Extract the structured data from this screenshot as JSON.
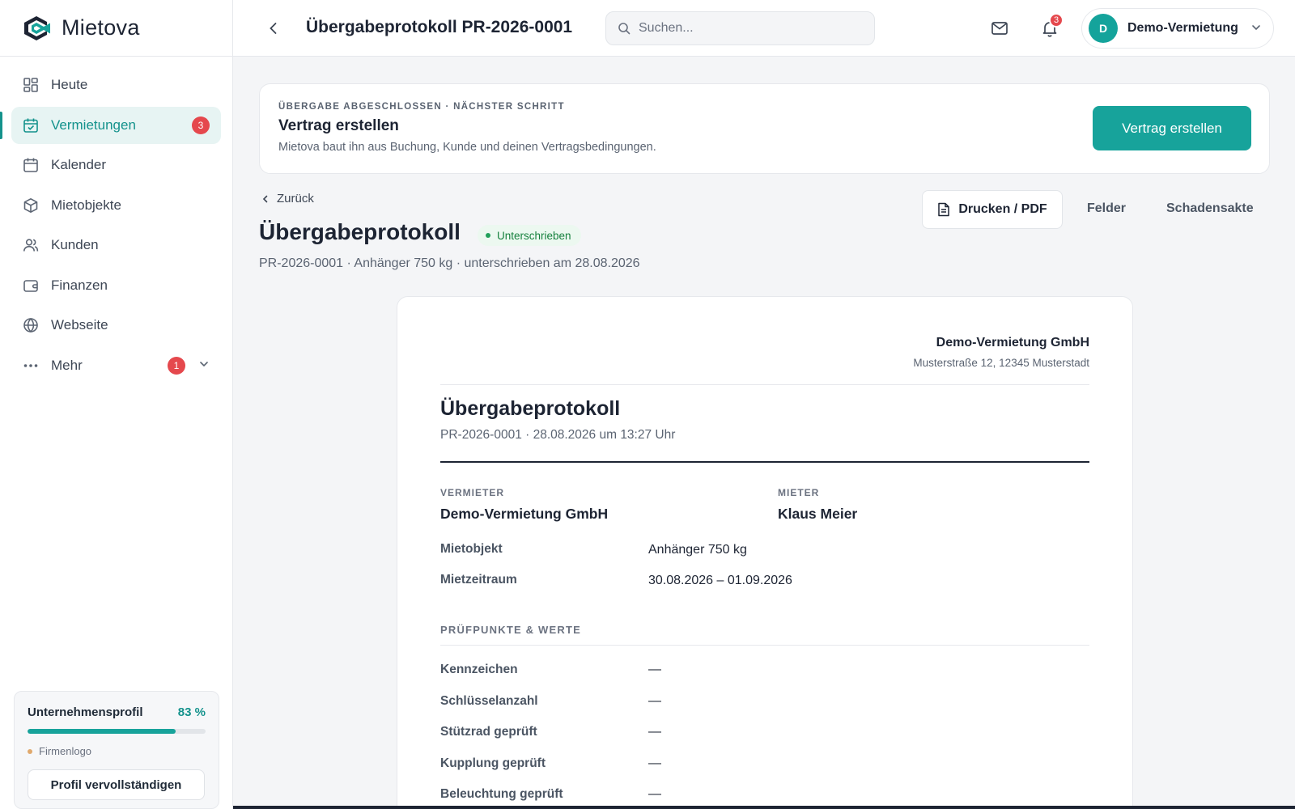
{
  "brand": {
    "name": "Mietova",
    "color": "#1d2433",
    "accent": "#14928c"
  },
  "sidebar": {
    "items": [
      {
        "label": "Heute",
        "icon": "grid-icon",
        "active": false,
        "badge": ""
      },
      {
        "label": "Vermietungen",
        "icon": "calendar-check-icon",
        "active": true,
        "badge": "3"
      },
      {
        "label": "Kalender",
        "icon": "calendar-icon",
        "active": false,
        "badge": ""
      },
      {
        "label": "Mietobjekte",
        "icon": "box-icon",
        "active": false,
        "badge": ""
      },
      {
        "label": "Kunden",
        "icon": "users-icon",
        "active": false,
        "badge": ""
      },
      {
        "label": "Finanzen",
        "icon": "wallet-icon",
        "active": false,
        "badge": ""
      },
      {
        "label": "Webseite",
        "icon": "globe-icon",
        "active": false,
        "badge": ""
      },
      {
        "label": "Mehr",
        "icon": "more-dots-icon",
        "active": false,
        "badge": "1"
      }
    ],
    "profile": {
      "title": "Unternehmensprofil",
      "percent_label": "83 %",
      "progress": 0.83,
      "todo": "Firmenlogo",
      "button": "Profil vervollständigen"
    }
  },
  "header": {
    "title": "Übergabeprotokoll PR-2026-0001",
    "search_placeholder": "Suchen...",
    "notification_count": "3",
    "account_initial": "D",
    "account_name": "Demo-Vermietung"
  },
  "banner": {
    "kicker": "ÜBERGABE ABGESCHLOSSEN · NÄCHSTER SCHRITT",
    "title": "Vertrag erstellen",
    "subtitle": "Mietova baut ihn aus Buchung, Kunde und deinen Vertragsbedingungen.",
    "cta": "Vertrag erstellen"
  },
  "doc_header": {
    "back": "Zurück",
    "title": "Übergabeprotokoll",
    "status": "Unterschrieben",
    "meta": "PR-2026-0001 · Anhänger 750 kg · unterschrieben am 28.08.2026",
    "actions": {
      "print": "Drucken / PDF",
      "fields": "Felder",
      "damage": "Schadensakte"
    }
  },
  "sheet": {
    "company_name": "Demo-Vermietung GmbH",
    "company_address": "Musterstraße 12, 12345 Musterstadt",
    "title": "Übergabeprotokoll",
    "subtitle": "PR-2026-0001 · 28.08.2026 um 13:27 Uhr",
    "landlord_label": "VERMIETER",
    "landlord": "Demo-Vermietung GmbH",
    "tenant_label": "MIETER",
    "tenant": "Klaus Meier",
    "details": [
      {
        "key": "Mietobjekt",
        "value": "Anhänger 750 kg"
      },
      {
        "key": "Mietzeitraum",
        "value": "30.08.2026 – 01.09.2026"
      }
    ],
    "checks_label": "PRÜFPUNKTE & WERTE",
    "checks": [
      {
        "key": "Kennzeichen",
        "value": "—"
      },
      {
        "key": "Schlüsselanzahl",
        "value": "—"
      },
      {
        "key": "Stützrad geprüft",
        "value": "—"
      },
      {
        "key": "Kupplung geprüft",
        "value": "—"
      },
      {
        "key": "Beleuchtung geprüft",
        "value": "—"
      }
    ]
  }
}
